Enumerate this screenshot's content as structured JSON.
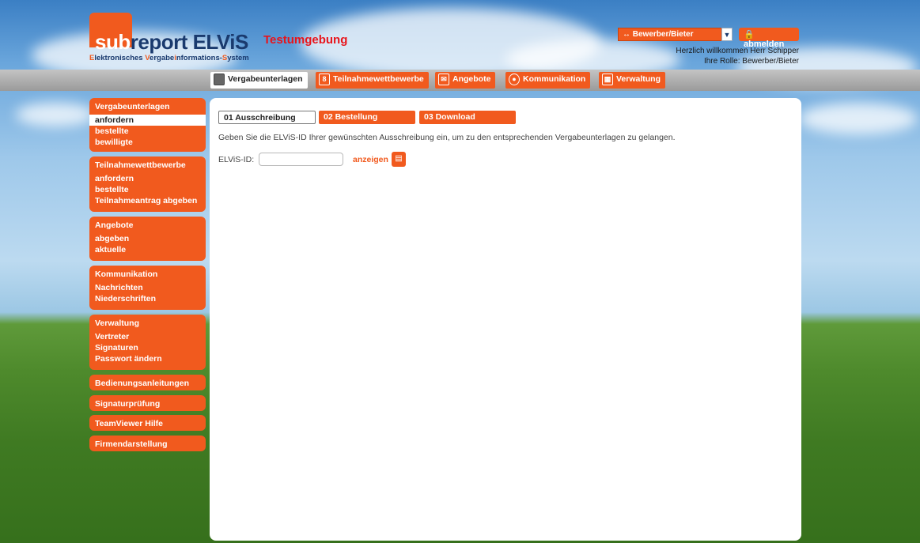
{
  "header": {
    "logo_sub": "sub",
    "logo_main": "report ELViS",
    "logo_tagline_1": "E",
    "logo_tagline_2": "lektronisches ",
    "logo_tagline_3": "V",
    "logo_tagline_4": "ergabe",
    "logo_tagline_5": "i",
    "logo_tagline_6": "nformations-",
    "logo_tagline_7": "S",
    "logo_tagline_8": "ystem",
    "env_title": "Testumgebung",
    "role_select_value": "↔ Bewerber/Bieter",
    "logout_label": "abmelden",
    "welcome_line": "Herzlich willkommen Herr Schipper",
    "role_line": "Ihre Rolle: Bewerber/Bieter"
  },
  "nav": {
    "tabs": [
      {
        "label": "Vergabeunterlagen",
        "icon": "document-icon"
      },
      {
        "label": "Teilnahmewettbewerbe",
        "icon": "form-icon"
      },
      {
        "label": "Angebote",
        "icon": "envelope-icon"
      },
      {
        "label": "Kommunikation",
        "icon": "chat-icon"
      },
      {
        "label": "Verwaltung",
        "icon": "calendar-icon"
      }
    ]
  },
  "sidebar": {
    "groups": [
      {
        "title": "Vergabeunterlagen",
        "items": [
          "anfordern",
          "bestellte",
          "bewilligte"
        ]
      },
      {
        "title": "Teilnahmewettbewerbe",
        "items": [
          "anfordern",
          "bestellte",
          "Teilnahmeantrag abgeben"
        ]
      },
      {
        "title": "Angebote",
        "items": [
          "abgeben",
          "aktuelle"
        ]
      },
      {
        "title": "Kommunikation",
        "items": [
          "Nachrichten",
          "Niederschriften"
        ]
      },
      {
        "title": "Verwaltung",
        "items": [
          "Vertreter",
          "Signaturen",
          "Passwort ändern"
        ]
      }
    ],
    "links": [
      "Bedienungsanleitungen",
      "Signaturprüfung",
      "TeamViewer Hilfe",
      "Firmendarstellung"
    ]
  },
  "main": {
    "subtabs": [
      "01 Ausschreibung",
      "02 Bestellung",
      "03 Download"
    ],
    "description": "Geben Sie die ELViS-ID Ihrer gewünschten Ausschreibung ein, um zu den entsprechenden Vergabeunterlagen zu gelangen.",
    "id_label": "ELViS-ID:",
    "id_value": "",
    "show_label": "anzeigen"
  },
  "colors": {
    "accent": "#f15a1e",
    "brand_blue": "#1a3a6e",
    "env_red": "#e8141b"
  }
}
